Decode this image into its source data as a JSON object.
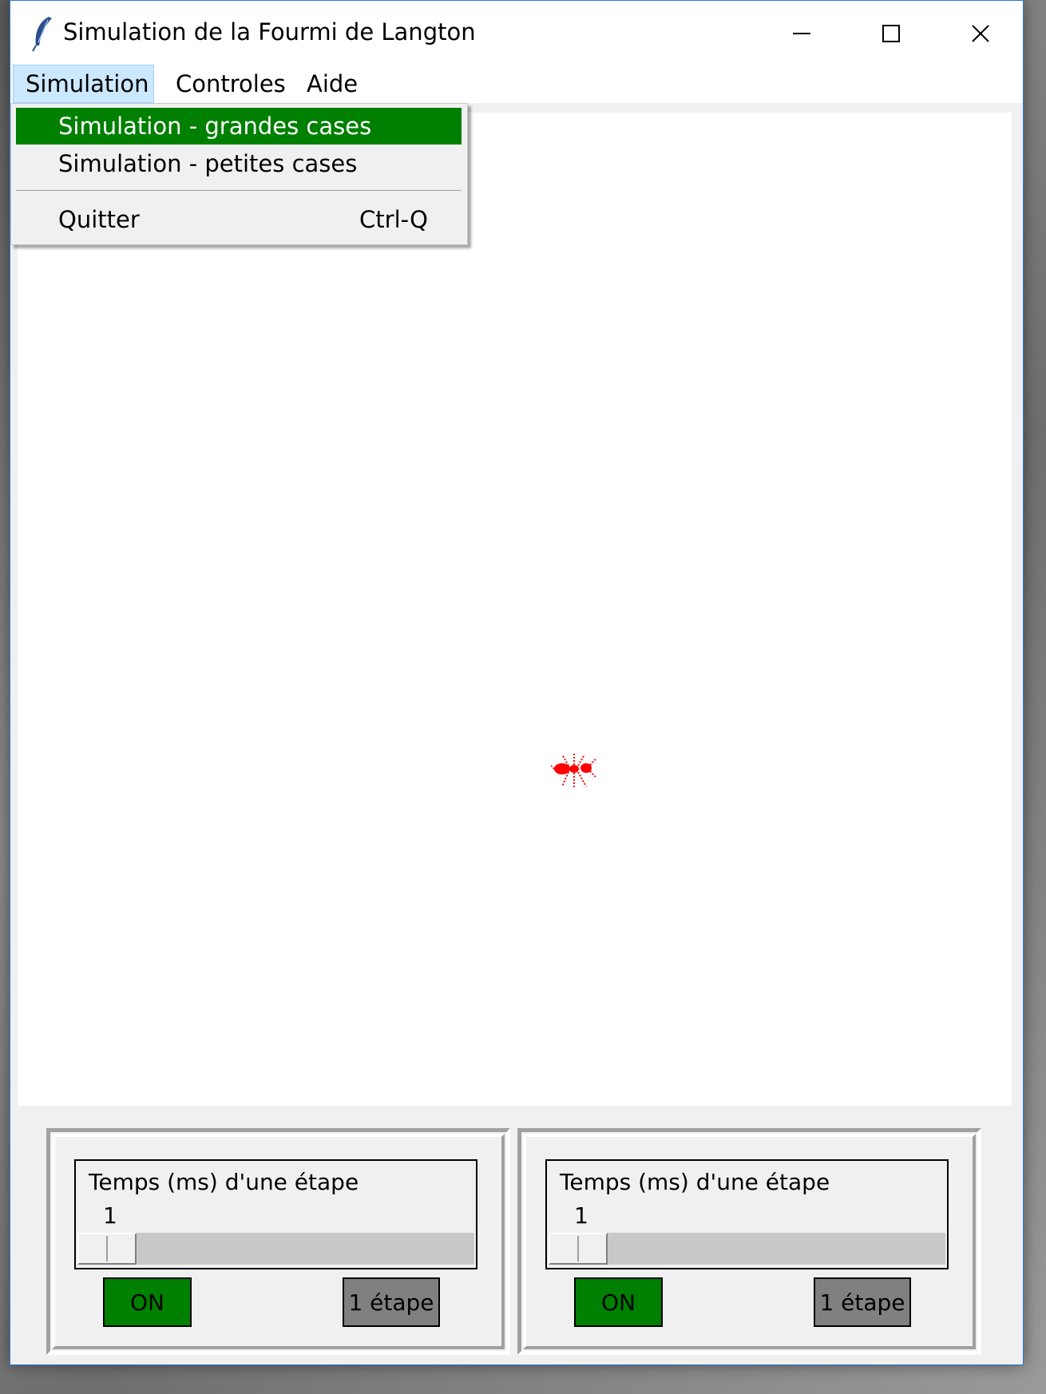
{
  "window": {
    "title": "Simulation de la Fourmi de Langton"
  },
  "menubar": {
    "items": [
      "Simulation",
      "Controles",
      "Aide"
    ]
  },
  "dropdown": {
    "items": [
      {
        "label": "Simulation - grandes cases",
        "accel": ""
      },
      {
        "label": "Simulation - petites cases",
        "accel": ""
      },
      {
        "label": "Quitter",
        "accel": "Ctrl-Q"
      }
    ]
  },
  "panels": [
    {
      "label": "Temps (ms) d'une étape",
      "value": "1",
      "slider_level": 0,
      "on_label": "ON",
      "step_label": "1 étape"
    },
    {
      "label": "Temps (ms) d'une étape",
      "value": "1",
      "slider_level": 0,
      "on_label": "ON",
      "step_label": "1 étape"
    }
  ],
  "colors": {
    "accent_green": "#008000",
    "ant": "#ff0000",
    "menu_active": "#cce8ff"
  },
  "icons": {
    "app": "feather-icon",
    "ant": "ant-icon"
  }
}
